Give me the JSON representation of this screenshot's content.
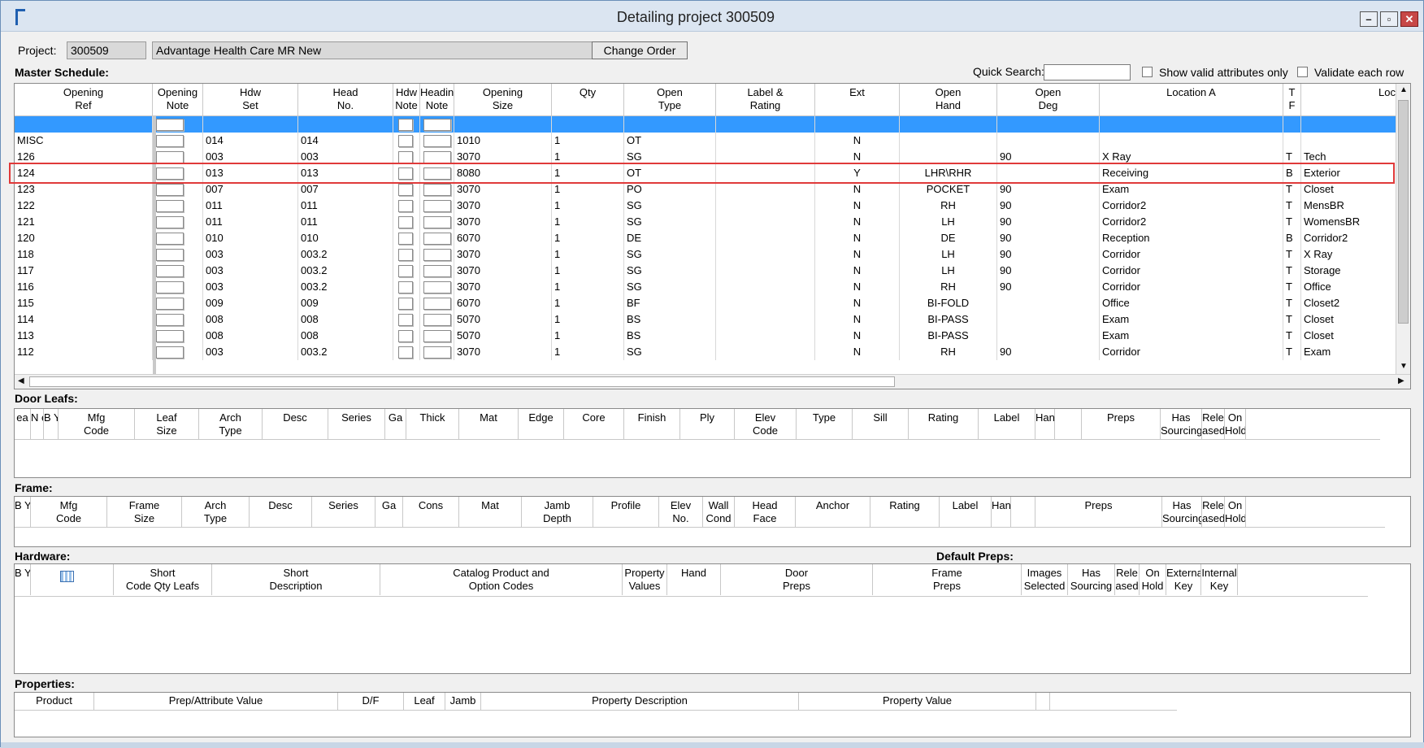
{
  "window": {
    "title": "Detailing project 300509",
    "buttons": [
      "–",
      "▫",
      "✕"
    ]
  },
  "project": {
    "label": "Project:",
    "number": "300509",
    "name": "Advantage Health Care MR New",
    "change_order_label": "Change Order"
  },
  "master": {
    "title": "Master Schedule:",
    "quick_search_label": "Quick Search:",
    "quick_search_value": "",
    "show_valid_label": "Show valid attributes only",
    "validate_label": "Validate each row",
    "columns": [
      {
        "l1": "Opening",
        "l2": "Ref"
      },
      {
        "l1": "Opening",
        "l2": "Note"
      },
      {
        "l1": "Hdw",
        "l2": "Set"
      },
      {
        "l1": "Head",
        "l2": "No."
      },
      {
        "l1": "Hdw",
        "l2": "Note"
      },
      {
        "l1": "Heading",
        "l2": "Note"
      },
      {
        "l1": "Opening",
        "l2": "Size"
      },
      {
        "l1": "",
        "l2": "Qty"
      },
      {
        "l1": "Open",
        "l2": "Type"
      },
      {
        "l1": "Label &",
        "l2": "Rating"
      },
      {
        "l1": "",
        "l2": "Ext"
      },
      {
        "l1": "Open",
        "l2": "Hand"
      },
      {
        "l1": "Open",
        "l2": "Deg"
      },
      {
        "l1": "",
        "l2": "Location A"
      },
      {
        "l1": "T",
        "l2": "F"
      },
      {
        "l1": "",
        "l2": "Loc"
      }
    ],
    "rows": [
      [
        "",
        "",
        "",
        "",
        "",
        "",
        "",
        "",
        "",
        "",
        "",
        "",
        "",
        "",
        "",
        ""
      ],
      [
        "MISC",
        "",
        "014",
        "014",
        "",
        "",
        "1010",
        "1",
        "OT",
        "",
        "N",
        "",
        "",
        "",
        "",
        ""
      ],
      [
        "126",
        "",
        "003",
        "003",
        "",
        "",
        "3070",
        "1",
        "SG",
        "",
        "N",
        "",
        "90",
        "X Ray",
        "T",
        "Tech"
      ],
      [
        "124",
        "",
        "013",
        "013",
        "",
        "",
        "8080",
        "1",
        "OT",
        "",
        "Y",
        "LHR\\RHR",
        "",
        "Receiving",
        "B",
        "Exterior"
      ],
      [
        "123",
        "",
        "007",
        "007",
        "",
        "",
        "3070",
        "1",
        "PO",
        "",
        "N",
        "POCKET",
        "90",
        "Exam",
        "T",
        "Closet"
      ],
      [
        "122",
        "",
        "011",
        "011",
        "",
        "",
        "3070",
        "1",
        "SG",
        "",
        "N",
        "RH",
        "90",
        "Corridor2",
        "T",
        "MensBR"
      ],
      [
        "121",
        "",
        "011",
        "011",
        "",
        "",
        "3070",
        "1",
        "SG",
        "",
        "N",
        "LH",
        "90",
        "Corridor2",
        "T",
        "WomensBR"
      ],
      [
        "120",
        "",
        "010",
        "010",
        "",
        "",
        "6070",
        "1",
        "DE",
        "",
        "N",
        "DE",
        "90",
        "Reception",
        "B",
        "Corridor2"
      ],
      [
        "118",
        "",
        "003",
        "003.2",
        "",
        "",
        "3070",
        "1",
        "SG",
        "",
        "N",
        "LH",
        "90",
        "Corridor",
        "T",
        "X Ray"
      ],
      [
        "117",
        "",
        "003",
        "003.2",
        "",
        "",
        "3070",
        "1",
        "SG",
        "",
        "N",
        "LH",
        "90",
        "Corridor",
        "T",
        "Storage"
      ],
      [
        "116",
        "",
        "003",
        "003.2",
        "",
        "",
        "3070",
        "1",
        "SG",
        "",
        "N",
        "RH",
        "90",
        "Corridor",
        "T",
        "Office"
      ],
      [
        "115",
        "",
        "009",
        "009",
        "",
        "",
        "6070",
        "1",
        "BF",
        "",
        "N",
        "BI-FOLD",
        "",
        "Office",
        "T",
        "Closet2"
      ],
      [
        "114",
        "",
        "008",
        "008",
        "",
        "",
        "5070",
        "1",
        "BS",
        "",
        "N",
        "BI-PASS",
        "",
        "Exam",
        "T",
        "Closet"
      ],
      [
        "113",
        "",
        "008",
        "008",
        "",
        "",
        "5070",
        "1",
        "BS",
        "",
        "N",
        "BI-PASS",
        "",
        "Exam",
        "T",
        "Closet"
      ],
      [
        "112",
        "",
        "003",
        "003.2",
        "",
        "",
        "3070",
        "1",
        "SG",
        "",
        "N",
        "RH",
        "90",
        "Corridor",
        "T",
        "Exam"
      ]
    ]
  },
  "door_leafs": {
    "title": "Door Leafs:",
    "columns": [
      {
        "l1": "",
        "l2": "ea"
      },
      {
        "l1": "N e t",
        "l2": ""
      },
      {
        "l1": "B Y O",
        "l2": ""
      },
      {
        "l1": "Mfg",
        "l2": "Code"
      },
      {
        "l1": "Leaf",
        "l2": "Size"
      },
      {
        "l1": "Arch",
        "l2": "Type"
      },
      {
        "l1": "",
        "l2": "Desc"
      },
      {
        "l1": "",
        "l2": "Series"
      },
      {
        "l1": "",
        "l2": "Ga"
      },
      {
        "l1": "",
        "l2": "Thick"
      },
      {
        "l1": "",
        "l2": "Mat"
      },
      {
        "l1": "",
        "l2": "Edge"
      },
      {
        "l1": "",
        "l2": "Core"
      },
      {
        "l1": "",
        "l2": "Finish"
      },
      {
        "l1": "",
        "l2": "Ply"
      },
      {
        "l1": "Elev",
        "l2": "Code"
      },
      {
        "l1": "",
        "l2": "Type"
      },
      {
        "l1": "",
        "l2": "Sill"
      },
      {
        "l1": "",
        "l2": "Rating"
      },
      {
        "l1": "",
        "l2": "Label"
      },
      {
        "l1": "",
        "l2": "Hand"
      },
      {
        "l1": "",
        "l2": ""
      },
      {
        "l1": "",
        "l2": "Preps"
      },
      {
        "l1": "Has",
        "l2": "Sourcing"
      },
      {
        "l1": "Rele",
        "l2": "ased"
      },
      {
        "l1": "On",
        "l2": "Hold"
      }
    ]
  },
  "frame": {
    "title": "Frame:",
    "columns": [
      {
        "l1": "B Y O",
        "l2": ""
      },
      {
        "l1": "Mfg",
        "l2": "Code"
      },
      {
        "l1": "Frame",
        "l2": "Size"
      },
      {
        "l1": "Arch",
        "l2": "Type"
      },
      {
        "l1": "",
        "l2": "Desc"
      },
      {
        "l1": "",
        "l2": "Series"
      },
      {
        "l1": "",
        "l2": "Ga"
      },
      {
        "l1": "",
        "l2": "Cons"
      },
      {
        "l1": "",
        "l2": "Mat"
      },
      {
        "l1": "Jamb",
        "l2": "Depth"
      },
      {
        "l1": "",
        "l2": "Profile"
      },
      {
        "l1": "Elev",
        "l2": "No."
      },
      {
        "l1": "Wall",
        "l2": "Cond"
      },
      {
        "l1": "Head",
        "l2": "Face"
      },
      {
        "l1": "",
        "l2": "Anchor"
      },
      {
        "l1": "",
        "l2": "Rating"
      },
      {
        "l1": "",
        "l2": "Label"
      },
      {
        "l1": "",
        "l2": "Hand"
      },
      {
        "l1": "",
        "l2": ""
      },
      {
        "l1": "",
        "l2": "Preps"
      },
      {
        "l1": "Has",
        "l2": "Sourcing"
      },
      {
        "l1": "Rele",
        "l2": "ased"
      },
      {
        "l1": "On",
        "l2": "Hold"
      }
    ]
  },
  "hardware": {
    "title": "Hardware:",
    "default_preps_title": "Default Preps:",
    "columns": [
      {
        "l1": "B Y O",
        "l2": ""
      },
      {
        "l1": "",
        "l2": ""
      },
      {
        "l1": "Short",
        "l2": "Code Qty Leafs"
      },
      {
        "l1": "Short",
        "l2": "Description"
      },
      {
        "l1": "Catalog Product and",
        "l2": "Option Codes"
      },
      {
        "l1": "Property",
        "l2": "Values"
      },
      {
        "l1": "",
        "l2": "Hand"
      },
      {
        "l1": "Door",
        "l2": "Preps"
      },
      {
        "l1": "Frame",
        "l2": "Preps"
      },
      {
        "l1": "Images",
        "l2": "Selected"
      },
      {
        "l1": "Has",
        "l2": "Sourcing"
      },
      {
        "l1": "Rele",
        "l2": "ased"
      },
      {
        "l1": "On",
        "l2": "Hold"
      },
      {
        "l1": "External",
        "l2": "Key"
      },
      {
        "l1": "Internal",
        "l2": "Key"
      }
    ]
  },
  "properties": {
    "title": "Properties:",
    "columns": [
      "Product",
      "Prep/Attribute Value",
      "D/F",
      "Leaf",
      "Jamb",
      "Property Description",
      "Property Value"
    ]
  }
}
